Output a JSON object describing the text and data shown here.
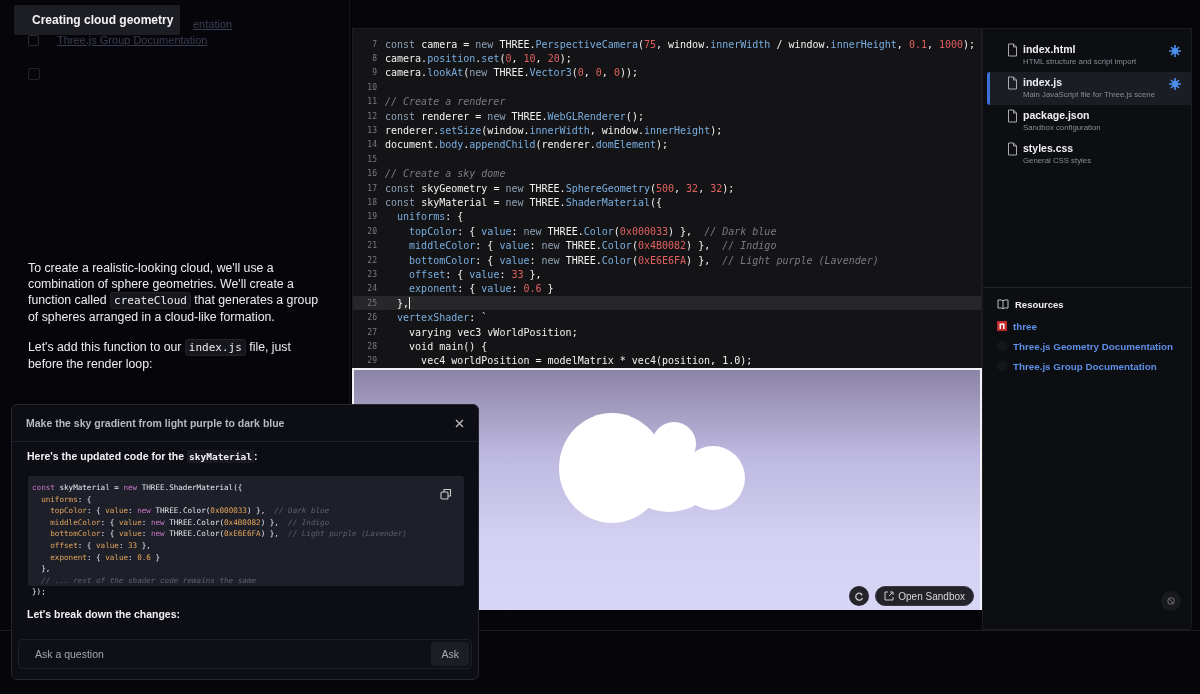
{
  "tooltip": {
    "text": "Creating cloud geometry"
  },
  "faded_links": [
    "entation",
    "Three.js Group Documentation"
  ],
  "chat": {
    "paragraphs": [
      [
        {
          "text": "To create a realistic-looking cloud, we'll use a combination of sphere geometries. We'll create a function called ",
          "code": false
        },
        {
          "text": "createCloud",
          "code": true
        },
        {
          "text": " that generates a group of spheres arranged in a cloud-like formation.",
          "code": false
        }
      ],
      [
        {
          "text": "Let's add this function to our ",
          "code": false
        },
        {
          "text": "index.js",
          "code": true
        },
        {
          "text": " file, just before the render loop:",
          "code": false
        }
      ]
    ]
  },
  "editor": {
    "lines": [
      {
        "number": "7",
        "current": false,
        "segments": [
          {
            "kind": "keyword",
            "text": "const"
          },
          {
            "kind": "plain",
            "text": " camera = "
          },
          {
            "kind": "keyword",
            "text": "new"
          },
          {
            "kind": "plain",
            "text": " THREE."
          },
          {
            "kind": "member",
            "text": "PerspectiveCamera"
          },
          {
            "kind": "plain",
            "text": "("
          },
          {
            "kind": "number",
            "text": "75"
          },
          {
            "kind": "plain",
            "text": ", window."
          },
          {
            "kind": "member",
            "text": "innerWidth"
          },
          {
            "kind": "plain",
            "text": " / window."
          },
          {
            "kind": "member",
            "text": "innerHeight"
          },
          {
            "kind": "plain",
            "text": ", "
          },
          {
            "kind": "number",
            "text": "0.1"
          },
          {
            "kind": "plain",
            "text": ", "
          },
          {
            "kind": "number",
            "text": "1000"
          },
          {
            "kind": "plain",
            "text": ");"
          }
        ]
      },
      {
        "number": "8",
        "current": false,
        "segments": [
          {
            "kind": "plain",
            "text": "camera."
          },
          {
            "kind": "member",
            "text": "position"
          },
          {
            "kind": "plain",
            "text": "."
          },
          {
            "kind": "member",
            "text": "set"
          },
          {
            "kind": "plain",
            "text": "("
          },
          {
            "kind": "number",
            "text": "0"
          },
          {
            "kind": "plain",
            "text": ", "
          },
          {
            "kind": "number",
            "text": "10"
          },
          {
            "kind": "plain",
            "text": ", "
          },
          {
            "kind": "number",
            "text": "20"
          },
          {
            "kind": "plain",
            "text": ");"
          }
        ]
      },
      {
        "number": "9",
        "current": false,
        "segments": [
          {
            "kind": "plain",
            "text": "camera."
          },
          {
            "kind": "member",
            "text": "lookAt"
          },
          {
            "kind": "plain",
            "text": "("
          },
          {
            "kind": "keyword",
            "text": "new"
          },
          {
            "kind": "plain",
            "text": " THREE."
          },
          {
            "kind": "member",
            "text": "Vector3"
          },
          {
            "kind": "plain",
            "text": "("
          },
          {
            "kind": "number",
            "text": "0"
          },
          {
            "kind": "plain",
            "text": ", "
          },
          {
            "kind": "number",
            "text": "0"
          },
          {
            "kind": "plain",
            "text": ", "
          },
          {
            "kind": "number",
            "text": "0"
          },
          {
            "kind": "plain",
            "text": "));"
          }
        ]
      },
      {
        "number": "10",
        "current": false
      },
      {
        "number": "11",
        "current": false,
        "segments": [
          {
            "kind": "comment",
            "text": "// Create a renderer"
          }
        ]
      },
      {
        "number": "12",
        "current": false,
        "segments": [
          {
            "kind": "keyword",
            "text": "const"
          },
          {
            "kind": "plain",
            "text": " renderer = "
          },
          {
            "kind": "keyword",
            "text": "new"
          },
          {
            "kind": "plain",
            "text": " THREE."
          },
          {
            "kind": "member",
            "text": "WebGLRenderer"
          },
          {
            "kind": "plain",
            "text": "();"
          }
        ]
      },
      {
        "number": "13",
        "current": false,
        "segments": [
          {
            "kind": "plain",
            "text": "renderer."
          },
          {
            "kind": "member",
            "text": "setSize"
          },
          {
            "kind": "plain",
            "text": "(window."
          },
          {
            "kind": "member",
            "text": "innerWidth"
          },
          {
            "kind": "plain",
            "text": ", window."
          },
          {
            "kind": "member",
            "text": "innerHeight"
          },
          {
            "kind": "plain",
            "text": ");"
          }
        ]
      },
      {
        "number": "14",
        "current": false,
        "segments": [
          {
            "kind": "plain",
            "text": "document."
          },
          {
            "kind": "member",
            "text": "body"
          },
          {
            "kind": "plain",
            "text": "."
          },
          {
            "kind": "member",
            "text": "appendChild"
          },
          {
            "kind": "plain",
            "text": "(renderer."
          },
          {
            "kind": "member",
            "text": "domElement"
          },
          {
            "kind": "plain",
            "text": ");"
          }
        ]
      },
      {
        "number": "15",
        "current": false
      },
      {
        "number": "16",
        "current": false,
        "segments": [
          {
            "kind": "comment",
            "text": "// Create a sky dome"
          }
        ]
      },
      {
        "number": "17",
        "current": false,
        "segments": [
          {
            "kind": "keyword",
            "text": "const"
          },
          {
            "kind": "plain",
            "text": " skyGeometry = "
          },
          {
            "kind": "keyword",
            "text": "new"
          },
          {
            "kind": "plain",
            "text": " THREE."
          },
          {
            "kind": "member",
            "text": "SphereGeometry"
          },
          {
            "kind": "plain",
            "text": "("
          },
          {
            "kind": "number",
            "text": "500"
          },
          {
            "kind": "plain",
            "text": ", "
          },
          {
            "kind": "number",
            "text": "32"
          },
          {
            "kind": "plain",
            "text": ", "
          },
          {
            "kind": "number",
            "text": "32"
          },
          {
            "kind": "plain",
            "text": ");"
          }
        ]
      },
      {
        "number": "18",
        "current": false,
        "segments": [
          {
            "kind": "keyword",
            "text": "const"
          },
          {
            "kind": "plain",
            "text": " skyMaterial = "
          },
          {
            "kind": "keyword",
            "text": "new"
          },
          {
            "kind": "plain",
            "text": " THREE."
          },
          {
            "kind": "member",
            "text": "ShaderMaterial"
          },
          {
            "kind": "plain",
            "text": "({"
          }
        ]
      },
      {
        "number": "19",
        "current": false,
        "segments": [
          {
            "kind": "member",
            "text": "  uniforms"
          },
          {
            "kind": "plain",
            "text": ": {"
          }
        ]
      },
      {
        "number": "20",
        "current": false,
        "segments": [
          {
            "kind": "member",
            "text": "    topColor"
          },
          {
            "kind": "plain",
            "text": ": { "
          },
          {
            "kind": "member",
            "text": "value"
          },
          {
            "kind": "plain",
            "text": ": "
          },
          {
            "kind": "keyword",
            "text": "new"
          },
          {
            "kind": "plain",
            "text": " THREE."
          },
          {
            "kind": "member",
            "text": "Color"
          },
          {
            "kind": "plain",
            "text": "("
          },
          {
            "kind": "number",
            "text": "0x000033"
          },
          {
            "kind": "plain",
            "text": ") },  "
          },
          {
            "kind": "comment",
            "text": "// Dark blue"
          }
        ]
      },
      {
        "number": "21",
        "current": false,
        "segments": [
          {
            "kind": "member",
            "text": "    middleColor"
          },
          {
            "kind": "plain",
            "text": ": { "
          },
          {
            "kind": "member",
            "text": "value"
          },
          {
            "kind": "plain",
            "text": ": "
          },
          {
            "kind": "keyword",
            "text": "new"
          },
          {
            "kind": "plain",
            "text": " THREE."
          },
          {
            "kind": "member",
            "text": "Color"
          },
          {
            "kind": "plain",
            "text": "("
          },
          {
            "kind": "number",
            "text": "0x4B0082"
          },
          {
            "kind": "plain",
            "text": ") },  "
          },
          {
            "kind": "comment",
            "text": "// Indigo"
          }
        ]
      },
      {
        "number": "22",
        "current": false,
        "segments": [
          {
            "kind": "member",
            "text": "    bottomColor"
          },
          {
            "kind": "plain",
            "text": ": { "
          },
          {
            "kind": "member",
            "text": "value"
          },
          {
            "kind": "plain",
            "text": ": "
          },
          {
            "kind": "keyword",
            "text": "new"
          },
          {
            "kind": "plain",
            "text": " THREE."
          },
          {
            "kind": "member",
            "text": "Color"
          },
          {
            "kind": "plain",
            "text": "("
          },
          {
            "kind": "number",
            "text": "0xE6E6FA"
          },
          {
            "kind": "plain",
            "text": ") },  "
          },
          {
            "kind": "comment",
            "text": "// Light purple (Lavender)"
          }
        ]
      },
      {
        "number": "23",
        "current": false,
        "segments": [
          {
            "kind": "member",
            "text": "    offset"
          },
          {
            "kind": "plain",
            "text": ": { "
          },
          {
            "kind": "member",
            "text": "value"
          },
          {
            "kind": "plain",
            "text": ": "
          },
          {
            "kind": "number",
            "text": "33"
          },
          {
            "kind": "plain",
            "text": " },"
          }
        ]
      },
      {
        "number": "24",
        "current": false,
        "segments": [
          {
            "kind": "member",
            "text": "    exponent"
          },
          {
            "kind": "plain",
            "text": ": { "
          },
          {
            "kind": "member",
            "text": "value"
          },
          {
            "kind": "plain",
            "text": ": "
          },
          {
            "kind": "number",
            "text": "0.6"
          },
          {
            "kind": "plain",
            "text": " }"
          }
        ]
      },
      {
        "number": "25",
        "current": true,
        "segments": [
          {
            "kind": "plain",
            "text": "  },"
          }
        ]
      },
      {
        "number": "26",
        "current": false,
        "segments": [
          {
            "kind": "member",
            "text": "  vertexShader"
          },
          {
            "kind": "plain",
            "text": ": `"
          }
        ]
      },
      {
        "number": "27",
        "current": false,
        "segments": [
          {
            "kind": "plain",
            "text": "    varying vec3 vWorldPosition;"
          }
        ]
      },
      {
        "number": "28",
        "current": false,
        "segments": [
          {
            "kind": "plain",
            "text": "    void main() {"
          }
        ]
      },
      {
        "number": "29",
        "current": false,
        "segments": [
          {
            "kind": "plain",
            "text": "      vec4 worldPosition = modelMatrix * vec4(position, 1.0);"
          }
        ]
      }
    ]
  },
  "preview": {
    "open_button": "Open Sandbox"
  },
  "files": [
    {
      "name": "index.html",
      "description": "HTML structure and script import",
      "selected": false,
      "modified": true
    },
    {
      "name": "index.js",
      "description": "Main JavaScript file for Three.js scene",
      "selected": true,
      "modified": true
    },
    {
      "name": "package.json",
      "description": "Sandbox configuration",
      "selected": false,
      "modified": false
    },
    {
      "name": "styles.css",
      "description": "General CSS styles",
      "selected": false,
      "modified": false
    }
  ],
  "resources": {
    "title": "Resources",
    "items": [
      {
        "kind": "package",
        "label": "three"
      },
      {
        "kind": "doc",
        "label": "Three.js Geometry Documentation"
      },
      {
        "kind": "doc",
        "label": "Three.js Group Documentation"
      }
    ]
  },
  "popup": {
    "title": "Make the sky gradient from light purple to dark blue",
    "intro": [
      {
        "text": "Here's the updated code for the ",
        "code": false
      },
      {
        "text": "skyMaterial",
        "code": true
      },
      {
        "text": ":",
        "code": false
      }
    ],
    "code": [
      [
        {
          "kind": "keyword",
          "text": "const"
        },
        {
          "kind": "plain",
          "text": " skyMaterial = "
        },
        {
          "kind": "keyword",
          "text": "new"
        },
        {
          "kind": "plain",
          "text": " THREE.ShaderMaterial({"
        }
      ],
      [
        {
          "kind": "member",
          "text": "  uniforms"
        },
        {
          "kind": "plain",
          "text": ": {"
        }
      ],
      [
        {
          "kind": "member",
          "text": "    topColor"
        },
        {
          "kind": "plain",
          "text": ": { "
        },
        {
          "kind": "member",
          "text": "value"
        },
        {
          "kind": "plain",
          "text": ": "
        },
        {
          "kind": "keyword",
          "text": "new"
        },
        {
          "kind": "plain",
          "text": " THREE.Color("
        },
        {
          "kind": "number",
          "text": "0x000033"
        },
        {
          "kind": "plain",
          "text": ") },  "
        },
        {
          "kind": "comment",
          "text": "// Dark blue"
        }
      ],
      [
        {
          "kind": "member",
          "text": "    middleColor"
        },
        {
          "kind": "plain",
          "text": ": { "
        },
        {
          "kind": "member",
          "text": "value"
        },
        {
          "kind": "plain",
          "text": ": "
        },
        {
          "kind": "keyword",
          "text": "new"
        },
        {
          "kind": "plain",
          "text": " THREE.Color("
        },
        {
          "kind": "number",
          "text": "0x4B0082"
        },
        {
          "kind": "plain",
          "text": ") },  "
        },
        {
          "kind": "comment",
          "text": "// Indigo"
        }
      ],
      [
        {
          "kind": "member",
          "text": "    bottomColor"
        },
        {
          "kind": "plain",
          "text": ": { "
        },
        {
          "kind": "member",
          "text": "value"
        },
        {
          "kind": "plain",
          "text": ": "
        },
        {
          "kind": "keyword",
          "text": "new"
        },
        {
          "kind": "plain",
          "text": " THREE.Color("
        },
        {
          "kind": "number",
          "text": "0xE6E6FA"
        },
        {
          "kind": "plain",
          "text": ") },  "
        },
        {
          "kind": "comment",
          "text": "// Light purple (Lavender)"
        }
      ],
      [
        {
          "kind": "member",
          "text": "    offset"
        },
        {
          "kind": "plain",
          "text": ": { "
        },
        {
          "kind": "member",
          "text": "value"
        },
        {
          "kind": "plain",
          "text": ": "
        },
        {
          "kind": "number",
          "text": "33"
        },
        {
          "kind": "plain",
          "text": " },"
        }
      ],
      [
        {
          "kind": "member",
          "text": "    exponent"
        },
        {
          "kind": "plain",
          "text": ": { "
        },
        {
          "kind": "member",
          "text": "value"
        },
        {
          "kind": "plain",
          "text": ": "
        },
        {
          "kind": "number",
          "text": "0.6"
        },
        {
          "kind": "plain",
          "text": " }"
        }
      ],
      [
        {
          "kind": "plain",
          "text": "  },"
        }
      ],
      [
        {
          "kind": "comment",
          "text": "  // ... rest of the shader code remains the same"
        }
      ],
      [
        {
          "kind": "plain",
          "text": "});"
        }
      ]
    ],
    "followup": "Let's break down the changes:",
    "input": {
      "placeholder": "Ask a question"
    },
    "ask_button": "Ask"
  }
}
